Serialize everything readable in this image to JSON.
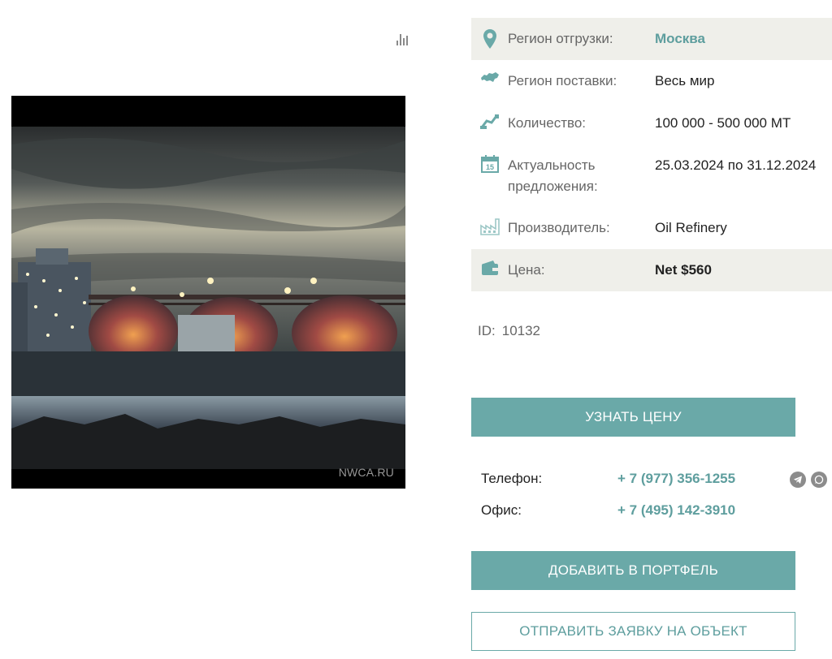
{
  "photo": {
    "watermark": "NWCA.RU"
  },
  "details": {
    "shipment_region": {
      "label": "Регион отгрузки:",
      "value": "Москва",
      "icon": "map-pin-icon"
    },
    "delivery_region": {
      "label": "Регион поставки:",
      "value": "Весь мир",
      "icon": "world-map-icon"
    },
    "quantity": {
      "label": "Количество:",
      "value": "100 000 - 500 000 МТ",
      "icon": "crane-icon"
    },
    "validity": {
      "label": "Актуальность предложения:",
      "value": "25.03.2024 по 31.12.2024",
      "icon": "calendar-icon",
      "calendar_day": "15"
    },
    "producer": {
      "label": "Производитель:",
      "value": "Oil Refinery",
      "icon": "factory-icon"
    },
    "price": {
      "label": "Цена:",
      "value": "Net $560",
      "icon": "wallet-icon"
    }
  },
  "id": {
    "label": "ID:",
    "value": "10132"
  },
  "buttons": {
    "get_price": "УЗНАТЬ ЦЕНУ",
    "add_portfolio": "ДОБАВИТЬ В ПОРТФЕЛЬ",
    "send_request": "ОТПРАВИТЬ ЗАЯВКУ НА ОБЪЕКТ"
  },
  "contacts": {
    "phone": {
      "label": "Телефон:",
      "value": "+ 7 (977) 356-1255"
    },
    "office": {
      "label": "Офис:",
      "value": "+ 7 (495) 142-3910"
    }
  },
  "colors": {
    "accent": "#6aa9a8",
    "accent_text": "#5e9e9e",
    "row_shade": "#efefea",
    "icon_muted": "#8c8c8c"
  }
}
